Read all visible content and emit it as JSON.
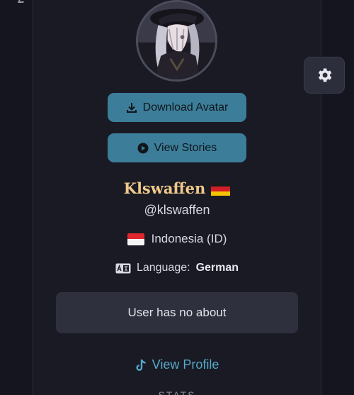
{
  "profile": {
    "display_name": "Klswaffen",
    "display_flag_icon": "germany-flag-icon",
    "handle": "@klswaffen",
    "country": "Indonesia (ID)",
    "country_flag_icon": "indonesia-flag-icon",
    "language_label": "Language:",
    "language_value": "German",
    "about": "User has no about"
  },
  "actions": {
    "download_avatar": "Download Avatar",
    "view_stories": "View Stories",
    "view_profile": "View Profile"
  },
  "sections": {
    "stats_heading": "STATS"
  },
  "icons": {
    "download": "download-icon",
    "play": "play-circle-icon",
    "language": "language-card-icon",
    "tiktok": "tiktok-icon",
    "settings": "gear-icon"
  },
  "colors": {
    "background": "#14151f",
    "card": "#191a24",
    "button": "#3c7e9a",
    "display_name": "#f0c98a",
    "link": "#56a8c8",
    "about_box": "#2f303d"
  }
}
